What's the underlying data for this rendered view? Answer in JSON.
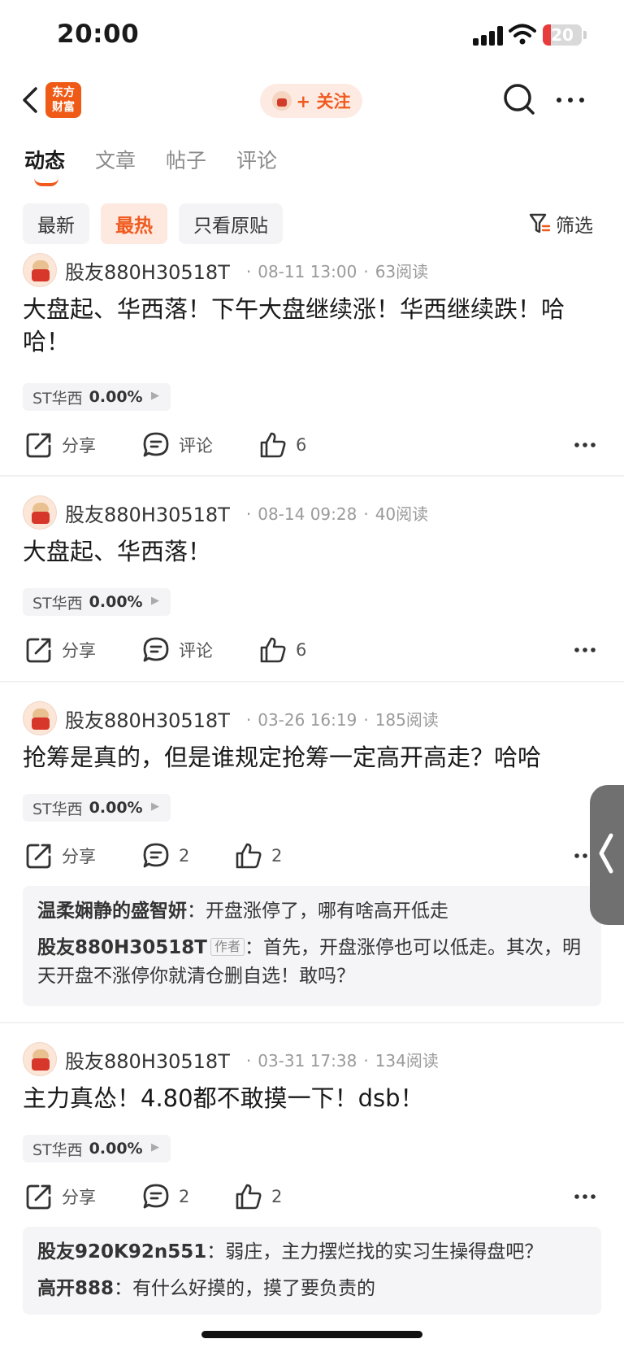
{
  "status": {
    "time": "20:00",
    "battery": "20",
    "battery_level": 0.2
  },
  "nav": {
    "logo_line1": "东方",
    "logo_line2": "财富",
    "follow_label": "+ 关注"
  },
  "tabs": [
    {
      "label": "动态"
    },
    {
      "label": "文章"
    },
    {
      "label": "帖子"
    },
    {
      "label": "评论"
    }
  ],
  "filters": {
    "chips": [
      "最新",
      "最热",
      "只看原贴"
    ],
    "filter_label": "筛选"
  },
  "posts": [
    {
      "user": "股友880H30518T",
      "time": "08-11 13:00",
      "reads": "63阅读",
      "text": "大盘起、华西落！下午大盘继续涨！华西继续跌！哈哈！",
      "stock": "ST华西",
      "change": "0.00%",
      "share": "分享",
      "comment": "评论",
      "likes": "6"
    },
    {
      "user": "股友880H30518T",
      "time": "08-14 09:28",
      "reads": "40阅读",
      "text": "大盘起、华西落！",
      "stock": "ST华西",
      "change": "0.00%",
      "share": "分享",
      "comment": "评论",
      "likes": "6"
    },
    {
      "user": "股友880H30518T",
      "time": "03-26 16:19",
      "reads": "185阅读",
      "text": "抢筹是真的，但是谁规定抢筹一定高开高走？哈哈",
      "stock": "ST华西",
      "change": "0.00%",
      "share": "分享",
      "comment": "2",
      "likes": "2",
      "replies": [
        {
          "user": "温柔娴静的盛智妍",
          "text": "开盘涨停了，哪有啥高开低走"
        },
        {
          "user": "股友880H30518T",
          "tag": "作者",
          "text": "首先，开盘涨停也可以低走。其次，明天开盘不涨停你就清仓删自选！敢吗？"
        }
      ]
    },
    {
      "user": "股友880H30518T",
      "time": "03-31 17:38",
      "reads": "134阅读",
      "text": "主力真怂！4.80都不敢摸一下！dsb！",
      "stock": "ST华西",
      "change": "0.00%",
      "share": "分享",
      "comment": "2",
      "likes": "2",
      "replies": [
        {
          "user": "股友920K92n551",
          "text": "弱庄，主力摆烂找的实习生操得盘吧？"
        },
        {
          "user": "高开888",
          "text": "有什么好摸的，摸了要负责的"
        }
      ]
    }
  ]
}
